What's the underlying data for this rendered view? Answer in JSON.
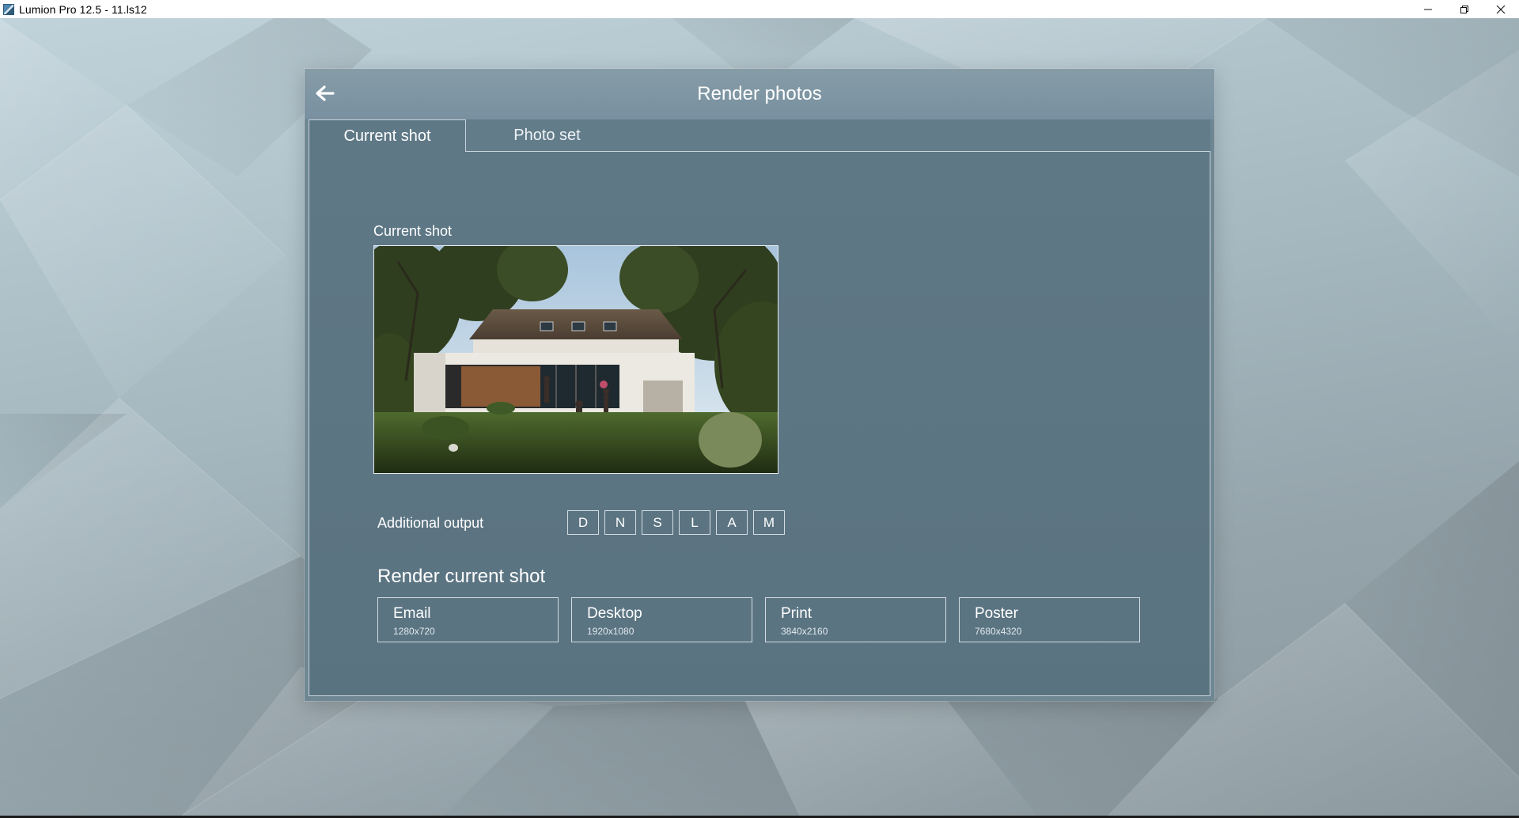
{
  "window": {
    "title": "Lumion Pro 12.5 - 11.ls12",
    "controls": [
      "minimize-icon",
      "restore-icon",
      "close-icon"
    ]
  },
  "dialog": {
    "title": "Render photos",
    "back_icon": "arrow-left-icon",
    "tabs": [
      {
        "label": "Current shot",
        "active": true
      },
      {
        "label": "Photo set",
        "active": false
      }
    ]
  },
  "current_shot": {
    "label": "Current shot",
    "preview_description": "house-render-thumbnail"
  },
  "additional_output": {
    "label": "Additional output",
    "buttons": [
      "D",
      "N",
      "S",
      "L",
      "A",
      "M"
    ]
  },
  "render": {
    "heading": "Render current shot",
    "presets": [
      {
        "label": "Email",
        "size": "1280x720"
      },
      {
        "label": "Desktop",
        "size": "1920x1080"
      },
      {
        "label": "Print",
        "size": "3840x2160"
      },
      {
        "label": "Poster",
        "size": "7680x4320"
      }
    ]
  },
  "colors": {
    "panel": "#5f7886",
    "header": "#7f96a2",
    "text": "#ffffff",
    "border": "#d4dde2"
  }
}
